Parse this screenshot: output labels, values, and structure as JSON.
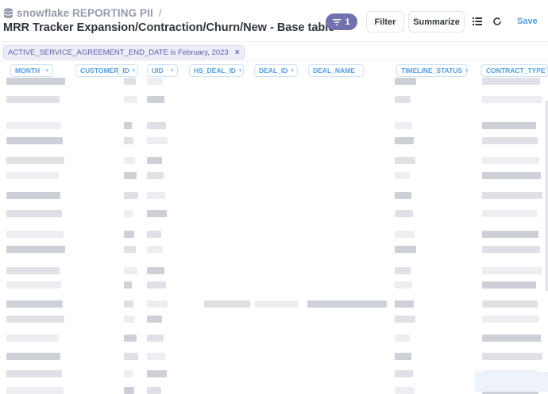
{
  "breadcrumb": {
    "database": "snowflake REPORTING PII",
    "separator": "/"
  },
  "question_title": "MRR Tracker Expansion/Contraction/Churn/New - Base table",
  "toolbar": {
    "filter_count": "1",
    "filter_label": "Filter",
    "summarize_label": "Summarize",
    "save_label": "Save"
  },
  "filter_chip": {
    "label": "ACTIVE_SERVICE_AGREEMENT_END_DATE is February, 2023",
    "close": "×"
  },
  "columns": [
    {
      "label": "MONTH"
    },
    {
      "label": "CUSTOMER_ID"
    },
    {
      "label": "UID"
    },
    {
      "label": "HS_DEAL_ID"
    },
    {
      "label": "DEAL_ID"
    },
    {
      "label": "DEAL_NAME"
    },
    {
      "label": "TIMELINE_STATUS"
    },
    {
      "label": "CONTRACT_TYPE"
    }
  ],
  "icons": {
    "database": "database-icon",
    "filter": "filter-lines-icon",
    "list": "list-view-icon",
    "refresh": "refresh-icon",
    "chevron": "chevron-down-icon"
  },
  "colors": {
    "accent": "#509ee3",
    "filter_pill": "#7172ad",
    "chip_bg": "#ecedf7"
  }
}
